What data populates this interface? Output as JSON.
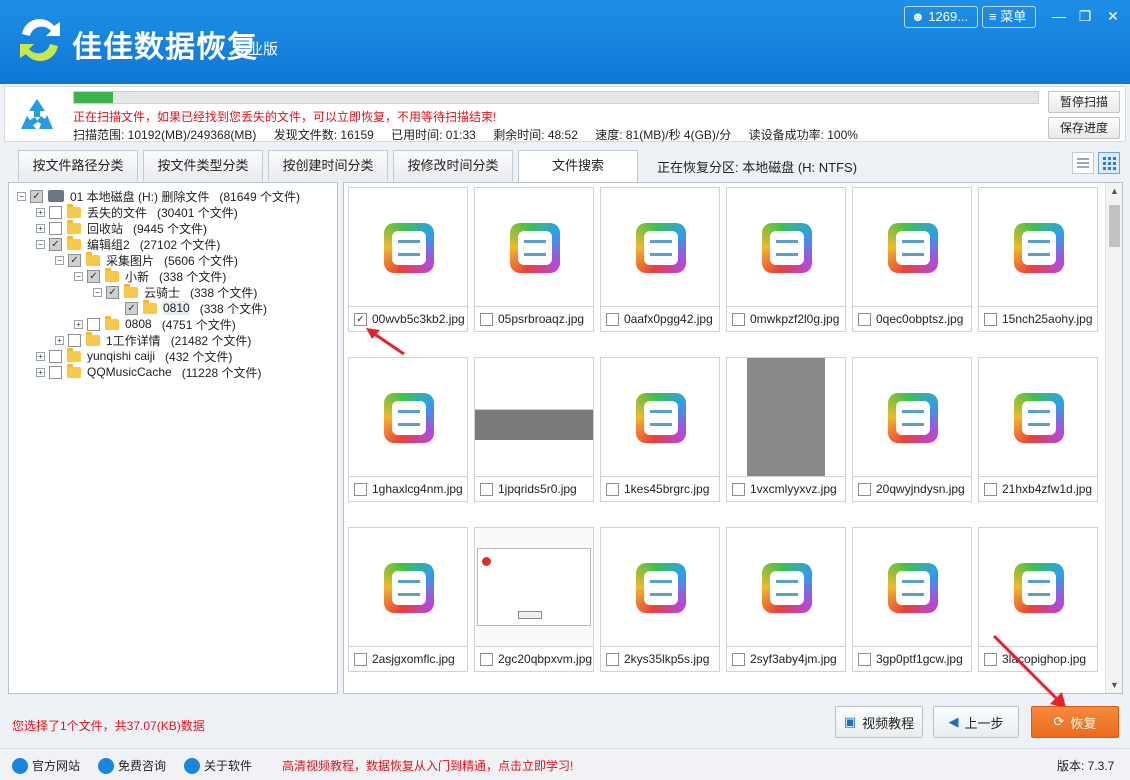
{
  "app": {
    "title": "佳佳数据恢复",
    "edition": "专业版",
    "user": "1269...",
    "menu": "菜单"
  },
  "scan": {
    "progress_fraction": 0.04,
    "message": "正在扫描文件，如果已经找到您丢失的文件，可以立即恢复，不用等待扫描结束!",
    "range": "扫描范围: 10192(MB)/249368(MB)",
    "found": "发现文件数: 16159",
    "elapsed": "已用时间: 01:33",
    "remaining": "剩余时间: 48:52",
    "speed": "速度: 81(MB)/秒  4(GB)/分",
    "read_rate": "读设备成功率: 100%",
    "pause_button": "暂停扫描",
    "save_button": "保存进度"
  },
  "tabs": [
    {
      "label": "按文件路径分类"
    },
    {
      "label": "按文件类型分类"
    },
    {
      "label": "按创建时间分类"
    },
    {
      "label": "按修改时间分类"
    },
    {
      "label": "文件搜索"
    }
  ],
  "partition": "正在恢复分区: 本地磁盘 (H: NTFS)",
  "tree": [
    {
      "label": "01 本地磁盘 (H:) 删除文件",
      "count": "(81649 个文件)"
    },
    {
      "label": "丢失的文件",
      "count": "(30401 个文件)"
    },
    {
      "label": "回收站",
      "count": "(9445 个文件)"
    },
    {
      "label": "编辑组2",
      "count": "(27102 个文件)"
    },
    {
      "label": "采集图片",
      "count": "(5606 个文件)"
    },
    {
      "label": "小新",
      "count": "(338 个文件)"
    },
    {
      "label": "云骑士",
      "count": "(338 个文件)"
    },
    {
      "label": "0810",
      "count": "(338 个文件)"
    },
    {
      "label": "0808",
      "count": "(4751 个文件)"
    },
    {
      "label": "1工作详情",
      "count": "(21482 个文件)"
    },
    {
      "label": "yunqishi caiji",
      "count": "(432 个文件)"
    },
    {
      "label": "QQMusicCache",
      "count": "(11228 个文件)"
    }
  ],
  "files": [
    {
      "name": "00wvb5c3kb2.jpg",
      "checked": true
    },
    {
      "name": "05psrbroaqz.jpg"
    },
    {
      "name": "0aafx0pgg42.jpg"
    },
    {
      "name": "0mwkpzf2l0g.jpg"
    },
    {
      "name": "0qec0obptsz.jpg"
    },
    {
      "name": "15nch25aohy.jpg"
    },
    {
      "name": "1ghaxlcg4nm.jpg"
    },
    {
      "name": "1jpqrids5r0.jpg"
    },
    {
      "name": "1kes45brgrc.jpg"
    },
    {
      "name": "1vxcmlyyxvz.jpg"
    },
    {
      "name": "20qwyjndysn.jpg"
    },
    {
      "name": "21hxb4zfw1d.jpg"
    },
    {
      "name": "2asjgxomflc.jpg"
    },
    {
      "name": "2gc20qbpxvm.jpg"
    },
    {
      "name": "2kys35lkp5s.jpg"
    },
    {
      "name": "2syf3aby4jm.jpg"
    },
    {
      "name": "3gp0ptf1gcw.jpg"
    },
    {
      "name": "3lacopighop.jpg"
    }
  ],
  "bottom": {
    "selection": "您选择了1个文件，共37.07(KB)数据",
    "video_button": "视频教程",
    "back_button": "上一步",
    "recover_button": "恢复"
  },
  "status": {
    "site": "官方网站",
    "consult": "免费咨询",
    "about": "关于软件",
    "promo": "高清视频教程，数据恢复从入门到精通，点击立即学习!",
    "version": "版本: 7.3.7"
  },
  "colors": {
    "titlebar": "#1b86e0",
    "alert": "#e0141e",
    "recover": "#f07a2d"
  }
}
